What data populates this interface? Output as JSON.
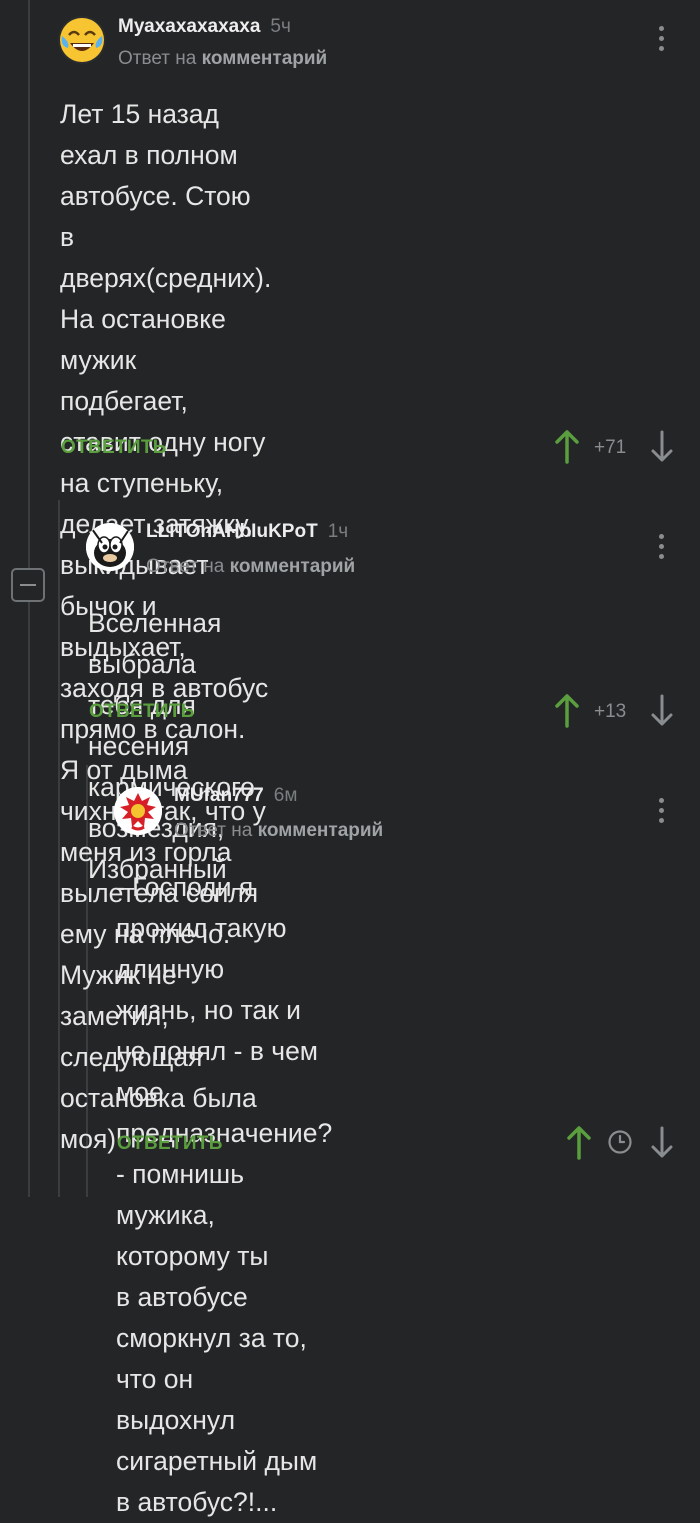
{
  "comments": [
    {
      "author": "Муахахахахаха",
      "time": "5ч",
      "reply_prefix": "Ответ на",
      "reply_target": "комментарий",
      "text": "Лет 15 назад ехал в полном автобусе. Стою\nв дверях(средних). На остановке мужик\nподбегает, ставит одну ногу на ступеньку,\nделает затяжку, выкидывает бычок и\nвыдыхает, заходя в автобус прямо в салон.\nЯ от дыма чихнул так, что у меня из горла\nвылетела сопля ему на плечо. Мужик не\nзаметил, следующая остановка была моя)",
      "reply_label": "ОТВЕТИТЬ",
      "rating": "+71",
      "avatar_icon": "laughing-crying-emoji"
    },
    {
      "author": "LLITOnAHbIuKPoT",
      "time": "1ч",
      "reply_prefix": "Ответ на",
      "reply_target": "комментарий",
      "text": "Вселенная выбрала тебя для несения\nкармического возмездия, Избранный",
      "reply_label": "ОТВЕТИТЬ",
      "rating": "+13",
      "avatar_icon": "cartoon-character"
    },
    {
      "author": "MUfan777",
      "time": "6м",
      "reply_prefix": "Ответ на",
      "reply_target": "комментарий",
      "text": "- Господи я прожил такую длинную\nжизнь, но так и не понял - в чем мое\nпредназначение?\n- помнишь мужика, которому ты\nв автобусе сморкнул за то, что он\nвыдохнул сигаретный дым в автобус?!...",
      "reply_label": "ОТВЕТИТЬ",
      "avatar_icon": "red-devil-logo"
    }
  ],
  "colors": {
    "background": "#232526",
    "reply_green": "#5a9e3e",
    "muted": "#8a8d90"
  }
}
